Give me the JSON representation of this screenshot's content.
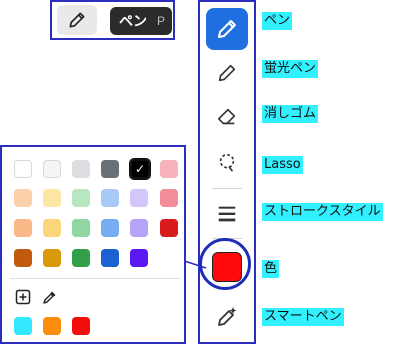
{
  "tooltip": {
    "label": "ペン",
    "shortcut": "P"
  },
  "toolbar": {
    "tools": [
      {
        "name": "pen",
        "label": "ペン",
        "icon": "pen-icon"
      },
      {
        "name": "highlighter",
        "label": "蛍光ペン",
        "icon": "highlighter-icon"
      },
      {
        "name": "eraser",
        "label": "消しゴム",
        "icon": "eraser-icon"
      },
      {
        "name": "lasso",
        "label": "Lasso",
        "icon": "lasso-icon"
      },
      {
        "name": "stroke-style",
        "label": "ストロークスタイル",
        "icon": "stroke-style-icon"
      },
      {
        "name": "color",
        "label": "色",
        "icon": "color-swatch"
      },
      {
        "name": "smart-pen",
        "label": "スマートペン",
        "icon": "smart-pen-icon"
      }
    ],
    "active_tool": "pen",
    "current_color": "#ff0a0a"
  },
  "palette": {
    "rows": [
      [
        "#ffffff",
        "#f5f5f6",
        "#dcdde0",
        "#6b7075",
        "#000000",
        "#f7b3bb"
      ],
      [
        "#fbd0ab",
        "#fde6a6",
        "#b8e6c1",
        "#a9c9f6",
        "#d3c6fb",
        "#f28c97"
      ],
      [
        "#fbb98a",
        "#fbd77b",
        "#8fd6a2",
        "#78adf2",
        "#b6a2f7",
        "#d81b1b"
      ],
      [
        "#c25a0d",
        "#d89a0a",
        "#32a04a",
        "#1b61d2",
        "#5b18f2",
        ""
      ]
    ],
    "selected_color": "#000000",
    "actions": [
      {
        "name": "add-color",
        "icon": "plus-square-icon"
      },
      {
        "name": "eyedropper",
        "icon": "eyedropper-icon"
      }
    ],
    "recent": [
      "#33e8ff",
      "#fb8c0c",
      "#f40b0b"
    ]
  }
}
